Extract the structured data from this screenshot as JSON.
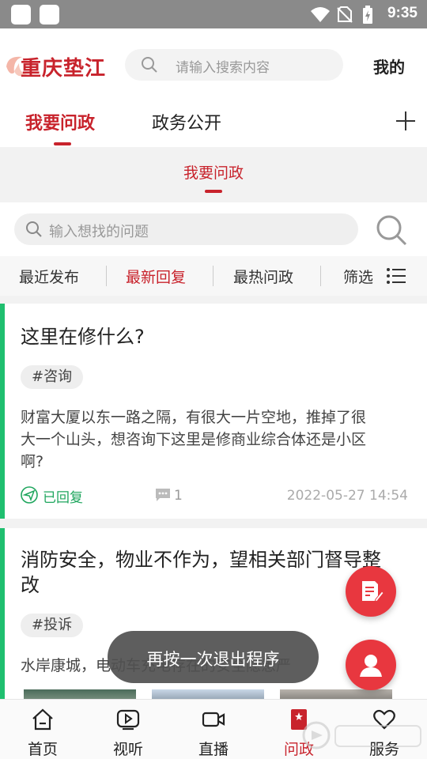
{
  "status_bar": {
    "time": "9:35",
    "icons": [
      "notification-square",
      "notification-square",
      "wifi-icon",
      "no-sim-icon",
      "battery-charging-icon"
    ]
  },
  "header": {
    "logo_text": "重庆垫江",
    "search_placeholder": "请输入搜索内容",
    "mine_label": "我的"
  },
  "tabs": [
    {
      "label": "我要问政",
      "active": true
    },
    {
      "label": "政务公开",
      "active": false
    }
  ],
  "subheader": {
    "title": "我要问政"
  },
  "question_search": {
    "placeholder": "输入想找的问题"
  },
  "filters": [
    {
      "label": "最近发布",
      "active": false
    },
    {
      "label": "最新回复",
      "active": true
    },
    {
      "label": "最热问政",
      "active": false
    },
    {
      "label": "筛选",
      "active": false
    }
  ],
  "posts": [
    {
      "title": "这里在修什么?",
      "tag": "#咨询",
      "content_lines": [
        "财富大厦以东一路之隔，有很大一片空地，推掉了很",
        "大一个山头，想咨询下这里是修商业综合体还是小区",
        "啊?"
      ],
      "status": "已回复",
      "comments": "1",
      "date": "2022-05-27 14:54"
    },
    {
      "title_lines": [
        "消防安全，物业不作为，望相关部门督导整",
        "改"
      ],
      "tag": "#投诉",
      "content_visible": "水岸康城，电动车充电存在的安全隐患严"
    }
  ],
  "toast": {
    "text": "再按一次退出程序"
  },
  "bottom_nav": [
    {
      "label": "首页",
      "icon": "home-icon"
    },
    {
      "label": "视听",
      "icon": "play-icon"
    },
    {
      "label": "直播",
      "icon": "video-camera-icon"
    },
    {
      "label": "问政",
      "icon": "flag-icon",
      "active": true
    },
    {
      "label": "服务",
      "icon": "heart-icon"
    }
  ],
  "colors": {
    "accent": "#c8232c",
    "green": "#1fbf6f",
    "fab": "#e8373f"
  }
}
